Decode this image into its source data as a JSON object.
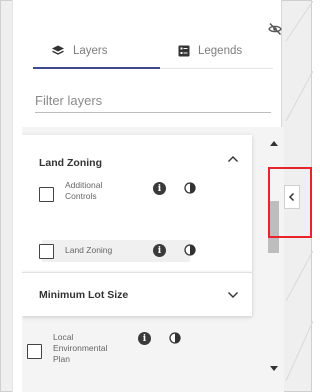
{
  "tabs": {
    "layers": {
      "label": "Layers",
      "icon": "layers-icon"
    },
    "legends": {
      "label": "Legends",
      "icon": "legend-list-icon"
    }
  },
  "filter": {
    "placeholder": "Filter layers",
    "value": ""
  },
  "groups": [
    {
      "title": "Land Zoning",
      "expanded": true,
      "layers": [
        {
          "label_lines": [
            "Additional",
            "Controls"
          ],
          "checked": false
        },
        {
          "label_lines": [
            "Land Zoning"
          ],
          "checked": false
        }
      ]
    },
    {
      "title": "Minimum Lot Size",
      "expanded": false,
      "layers": [
        {
          "label_lines": [
            "Local",
            "Environmental",
            "Plan"
          ],
          "checked": false
        }
      ]
    }
  ],
  "colors": {
    "accent": "#3e4a8e",
    "highlight": "#e8232a"
  },
  "icons": [
    "eye-off-icon",
    "layers-icon",
    "legend-list-icon",
    "chevron-up-icon",
    "chevron-down-icon",
    "info-icon",
    "opacity-icon",
    "scroll-up-arrow-icon",
    "scroll-down-arrow-icon",
    "chevron-left-icon"
  ]
}
